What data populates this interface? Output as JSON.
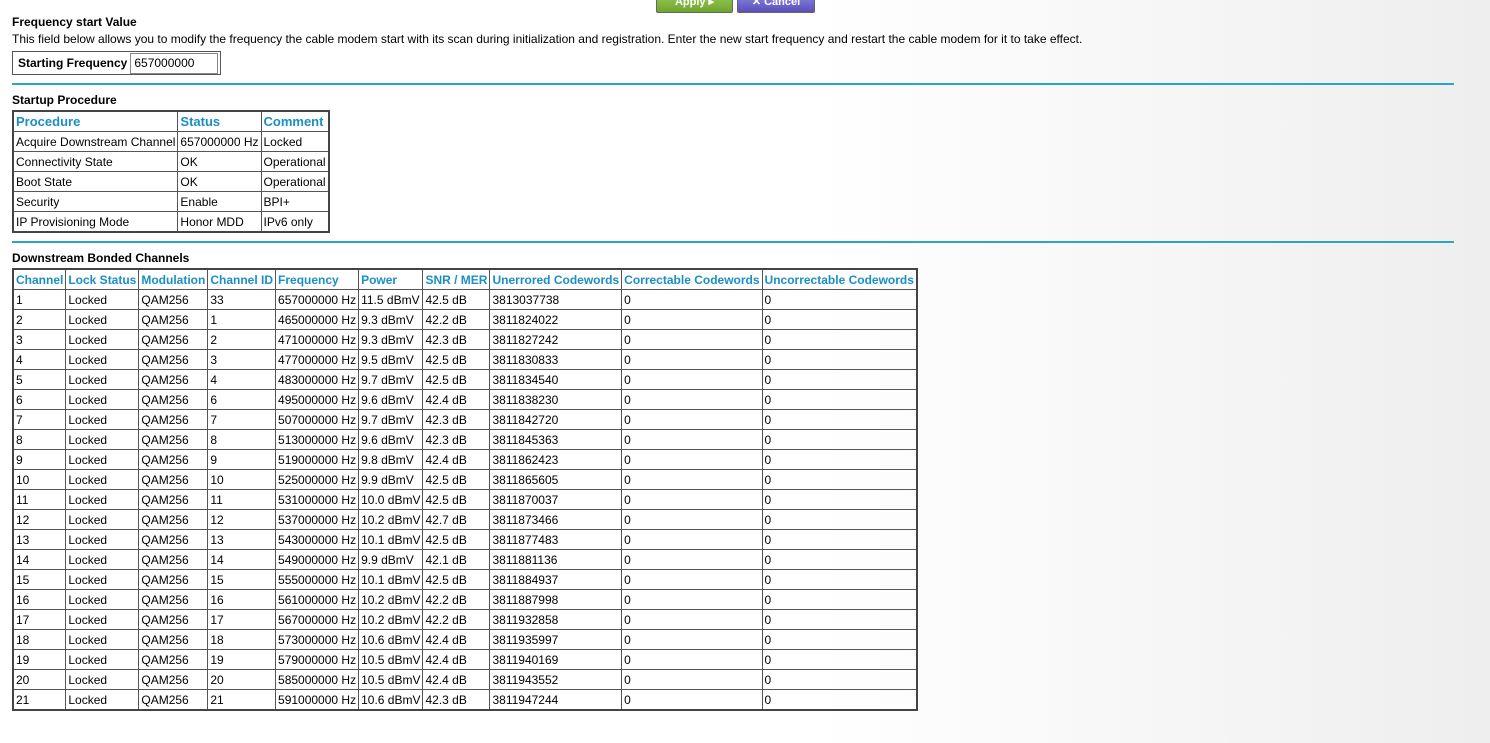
{
  "buttons": {
    "apply_label": "Apply",
    "cancel_label": "Cancel"
  },
  "frequency": {
    "title": "Frequency start Value",
    "description": "This field below allows you to modify the frequency the cable modem start with its scan during initialization and registration. Enter the new start frequency and restart the cable modem for it to take effect.",
    "label": "Starting Frequency",
    "value": "657000000"
  },
  "startup": {
    "title": "Startup Procedure",
    "headers": [
      "Procedure",
      "Status",
      "Comment"
    ],
    "rows": [
      [
        "Acquire Downstream Channel",
        "657000000 Hz",
        "Locked"
      ],
      [
        "Connectivity State",
        "OK",
        "Operational"
      ],
      [
        "Boot State",
        "OK",
        "Operational"
      ],
      [
        "Security",
        "Enable",
        "BPI+"
      ],
      [
        "IP Provisioning Mode",
        "Honor MDD",
        "IPv6 only"
      ]
    ]
  },
  "downstream": {
    "title": "Downstream Bonded Channels",
    "headers": [
      "Channel",
      "Lock Status",
      "Modulation",
      "Channel ID",
      "Frequency",
      "Power",
      "SNR / MER",
      "Unerrored Codewords",
      "Correctable Codewords",
      "Uncorrectable Codewords"
    ],
    "rows": [
      [
        "1",
        "Locked",
        "QAM256",
        "33",
        "657000000 Hz",
        "11.5 dBmV",
        "42.5 dB",
        "3813037738",
        "0",
        "0"
      ],
      [
        "2",
        "Locked",
        "QAM256",
        "1",
        "465000000 Hz",
        "9.3 dBmV",
        "42.2 dB",
        "3811824022",
        "0",
        "0"
      ],
      [
        "3",
        "Locked",
        "QAM256",
        "2",
        "471000000 Hz",
        "9.3 dBmV",
        "42.3 dB",
        "3811827242",
        "0",
        "0"
      ],
      [
        "4",
        "Locked",
        "QAM256",
        "3",
        "477000000 Hz",
        "9.5 dBmV",
        "42.5 dB",
        "3811830833",
        "0",
        "0"
      ],
      [
        "5",
        "Locked",
        "QAM256",
        "4",
        "483000000 Hz",
        "9.7 dBmV",
        "42.5 dB",
        "3811834540",
        "0",
        "0"
      ],
      [
        "6",
        "Locked",
        "QAM256",
        "6",
        "495000000 Hz",
        "9.6 dBmV",
        "42.4 dB",
        "3811838230",
        "0",
        "0"
      ],
      [
        "7",
        "Locked",
        "QAM256",
        "7",
        "507000000 Hz",
        "9.7 dBmV",
        "42.3 dB",
        "3811842720",
        "0",
        "0"
      ],
      [
        "8",
        "Locked",
        "QAM256",
        "8",
        "513000000 Hz",
        "9.6 dBmV",
        "42.3 dB",
        "3811845363",
        "0",
        "0"
      ],
      [
        "9",
        "Locked",
        "QAM256",
        "9",
        "519000000 Hz",
        "9.8 dBmV",
        "42.4 dB",
        "3811862423",
        "0",
        "0"
      ],
      [
        "10",
        "Locked",
        "QAM256",
        "10",
        "525000000 Hz",
        "9.9 dBmV",
        "42.5 dB",
        "3811865605",
        "0",
        "0"
      ],
      [
        "11",
        "Locked",
        "QAM256",
        "11",
        "531000000 Hz",
        "10.0 dBmV",
        "42.5 dB",
        "3811870037",
        "0",
        "0"
      ],
      [
        "12",
        "Locked",
        "QAM256",
        "12",
        "537000000 Hz",
        "10.2 dBmV",
        "42.7 dB",
        "3811873466",
        "0",
        "0"
      ],
      [
        "13",
        "Locked",
        "QAM256",
        "13",
        "543000000 Hz",
        "10.1 dBmV",
        "42.5 dB",
        "3811877483",
        "0",
        "0"
      ],
      [
        "14",
        "Locked",
        "QAM256",
        "14",
        "549000000 Hz",
        "9.9 dBmV",
        "42.1 dB",
        "3811881136",
        "0",
        "0"
      ],
      [
        "15",
        "Locked",
        "QAM256",
        "15",
        "555000000 Hz",
        "10.1 dBmV",
        "42.5 dB",
        "3811884937",
        "0",
        "0"
      ],
      [
        "16",
        "Locked",
        "QAM256",
        "16",
        "561000000 Hz",
        "10.2 dBmV",
        "42.2 dB",
        "3811887998",
        "0",
        "0"
      ],
      [
        "17",
        "Locked",
        "QAM256",
        "17",
        "567000000 Hz",
        "10.2 dBmV",
        "42.2 dB",
        "3811932858",
        "0",
        "0"
      ],
      [
        "18",
        "Locked",
        "QAM256",
        "18",
        "573000000 Hz",
        "10.6 dBmV",
        "42.4 dB",
        "3811935997",
        "0",
        "0"
      ],
      [
        "19",
        "Locked",
        "QAM256",
        "19",
        "579000000 Hz",
        "10.5 dBmV",
        "42.4 dB",
        "3811940169",
        "0",
        "0"
      ],
      [
        "20",
        "Locked",
        "QAM256",
        "20",
        "585000000 Hz",
        "10.5 dBmV",
        "42.4 dB",
        "3811943552",
        "0",
        "0"
      ],
      [
        "21",
        "Locked",
        "QAM256",
        "21",
        "591000000 Hz",
        "10.6 dBmV",
        "42.3 dB",
        "3811947244",
        "0",
        "0"
      ]
    ]
  }
}
